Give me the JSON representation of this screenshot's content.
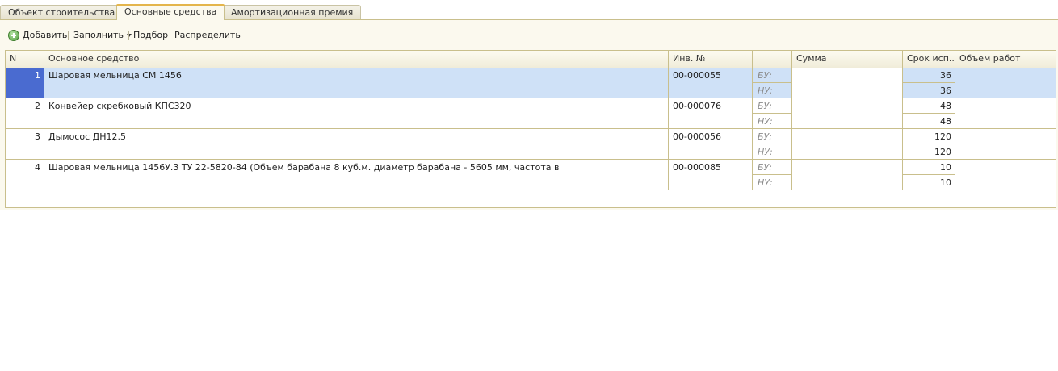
{
  "tabs": [
    {
      "label": "Объект строительства"
    },
    {
      "label": "Основные средства"
    },
    {
      "label": "Амортизационная премия"
    }
  ],
  "toolbar": {
    "add_label": "Добавить",
    "fill_label": "Заполнить",
    "pick_label": "Подбор",
    "distribute_label": "Распределить"
  },
  "table": {
    "columns": {
      "n": "N",
      "asset": "Основное средство",
      "inv": "Инв. №",
      "kind": "",
      "sum": "Сумма",
      "term": "Срок исп...",
      "volume": "Объем работ"
    },
    "accounting_labels": {
      "bu": "БУ:",
      "nu": "НУ:"
    },
    "rows": [
      {
        "n": "1",
        "asset": "Шаровая мельница СМ 1456",
        "inv": "00-000055",
        "term_bu": "36",
        "term_nu": "36"
      },
      {
        "n": "2",
        "asset": "Конвейер скребковый КПС320",
        "inv": "00-000076",
        "term_bu": "48",
        "term_nu": "48"
      },
      {
        "n": "3",
        "asset": "Дымосос ДН12.5",
        "inv": "00-000056",
        "term_bu": "120",
        "term_nu": "120"
      },
      {
        "n": "4",
        "asset": "Шаровая мельница 1456У.3 ТУ 22-5820-84 (Объем барабана 8 куб.м. диаметр барабана - 5605 мм, частота в",
        "inv": "00-000085",
        "term_bu": "10",
        "term_nu": "10"
      }
    ]
  },
  "colors": {
    "selected_row": "#cfe1f7",
    "selected_number": "#4a6bd0",
    "active_tab_accent": "#e4b54c"
  }
}
